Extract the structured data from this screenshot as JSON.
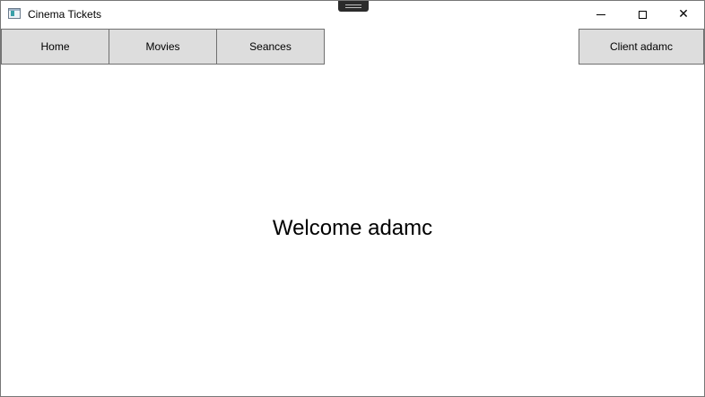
{
  "window": {
    "title": "Cinema Tickets",
    "icon": "app-window-icon",
    "caption_buttons": {
      "minimize_icon": "minimize-icon",
      "maximize_icon": "maximize-icon",
      "close_glyph": "✕"
    }
  },
  "nav": {
    "home_label": "Home",
    "movies_label": "Movies",
    "seances_label": "Seances",
    "client_label": "Client adamc"
  },
  "main": {
    "welcome_text": "Welcome adamc"
  },
  "colors": {
    "button_bg": "#dddddd",
    "button_border": "#707070",
    "background": "#ffffff"
  }
}
